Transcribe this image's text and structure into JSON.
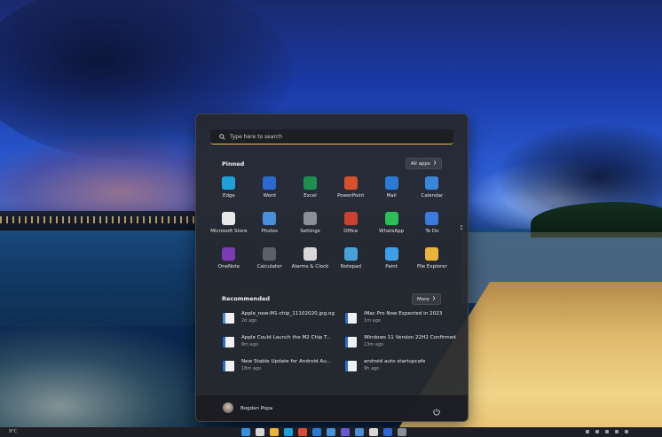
{
  "search": {
    "placeholder": "Type here to search"
  },
  "pinned": {
    "title": "Pinned",
    "all_apps_label": "All apps",
    "apps": [
      {
        "label": "Edge",
        "icon": "edge-icon",
        "color": "#1fa0d8"
      },
      {
        "label": "Word",
        "icon": "word-icon",
        "color": "#2b6bd1"
      },
      {
        "label": "Excel",
        "icon": "excel-icon",
        "color": "#1e8e4e"
      },
      {
        "label": "PowerPoint",
        "icon": "powerpoint-icon",
        "color": "#d5502b"
      },
      {
        "label": "Mail",
        "icon": "mail-icon",
        "color": "#2b7ad8"
      },
      {
        "label": "Calendar",
        "icon": "calendar-icon",
        "color": "#3a86d8"
      },
      {
        "label": "Microsoft Store",
        "icon": "store-icon",
        "color": "#e8e8e8"
      },
      {
        "label": "Photos",
        "icon": "photos-icon",
        "color": "#4a8fd8"
      },
      {
        "label": "Settings",
        "icon": "gear-icon",
        "color": "#8a8f98"
      },
      {
        "label": "Office",
        "icon": "office-icon",
        "color": "#c8432f"
      },
      {
        "label": "WhatsApp",
        "icon": "whatsapp-icon",
        "color": "#2bbf5a"
      },
      {
        "label": "To Do",
        "icon": "todo-icon",
        "color": "#3a7be0"
      },
      {
        "label": "OneNote",
        "icon": "onenote-icon",
        "color": "#7a3bb8"
      },
      {
        "label": "Calculator",
        "icon": "calculator-icon",
        "color": "#5c6068"
      },
      {
        "label": "Alarms & Clock",
        "icon": "clock-icon",
        "color": "#d8d8d8"
      },
      {
        "label": "Notepad",
        "icon": "notepad-icon",
        "color": "#4aa0d8"
      },
      {
        "label": "Paint",
        "icon": "paint-icon",
        "color": "#3f9ee8"
      },
      {
        "label": "File Explorer",
        "icon": "folder-icon",
        "color": "#e8b43a"
      }
    ]
  },
  "recommended": {
    "title": "Recommended",
    "more_label": "More",
    "items": [
      {
        "name": "Apple_new-M1-chip_11102020.jpg.og",
        "time": "2d ago",
        "icon": "image-file-icon",
        "color": "#4a8fd8"
      },
      {
        "name": "iMac Pro Now Expected in 2023",
        "time": "1m ago",
        "icon": "word-file-icon",
        "color": "#2b6bd1"
      },
      {
        "name": "Apple Could Launch the M2 Chip T...",
        "time": "8m ago",
        "icon": "word-file-icon",
        "color": "#2b6bd1"
      },
      {
        "name": "Windows 11 Version 22H2 Confirmed",
        "time": "13m ago",
        "icon": "word-file-icon",
        "color": "#2b6bd1"
      },
      {
        "name": "New Stable Update for Android Au...",
        "time": "18m ago",
        "icon": "word-file-icon",
        "color": "#2b6bd1"
      },
      {
        "name": "android auto startupcafe",
        "time": "9h ago",
        "icon": "word-file-icon",
        "color": "#2b6bd1"
      }
    ]
  },
  "user": {
    "name": "Bogdan Popa"
  },
  "taskbar": {
    "weather": "9°C",
    "icons": [
      {
        "name": "start-icon",
        "color": "#3a8fe0"
      },
      {
        "name": "search-icon",
        "color": "#d8d8d8"
      },
      {
        "name": "file-explorer-icon",
        "color": "#e8b43a"
      },
      {
        "name": "edge-icon",
        "color": "#1fa0d8"
      },
      {
        "name": "chrome-icon",
        "color": "#d84a3a"
      },
      {
        "name": "mail-icon",
        "color": "#2b7ad8"
      },
      {
        "name": "store-icon",
        "color": "#4a8fd8"
      },
      {
        "name": "teams-icon",
        "color": "#6a5ad0"
      },
      {
        "name": "photos-icon",
        "color": "#4a8fd8"
      },
      {
        "name": "calendar-icon",
        "color": "#d8d8d8"
      },
      {
        "name": "word-icon",
        "color": "#2b6bd1"
      },
      {
        "name": "settings-icon",
        "color": "#8a8f98"
      }
    ]
  }
}
